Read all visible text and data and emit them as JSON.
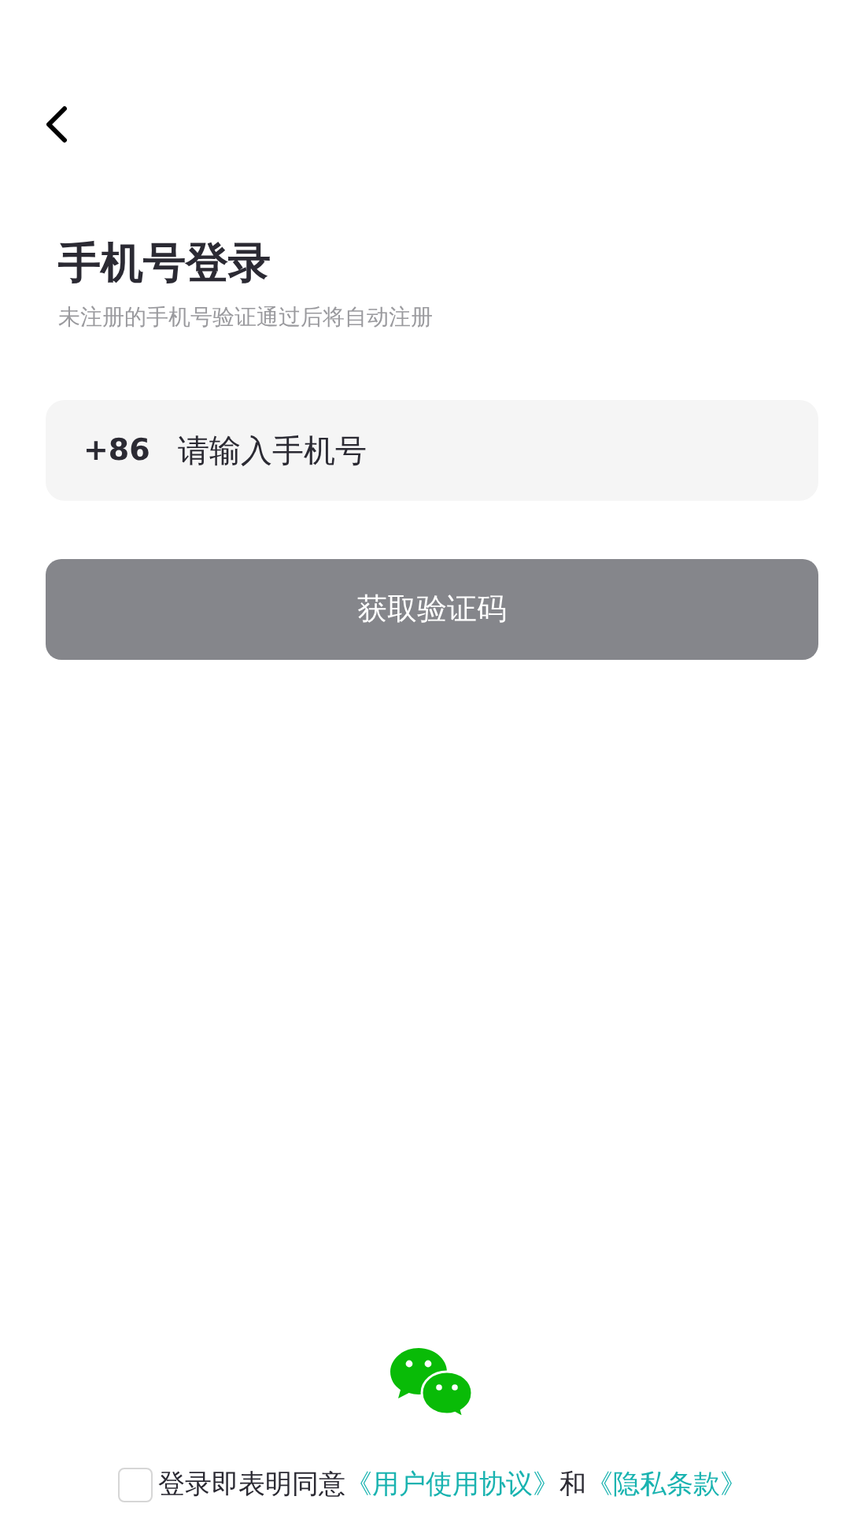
{
  "title": "手机号登录",
  "subtitle": "未注册的手机号验证通过后将自动注册",
  "phone_field": {
    "country_code": "+86",
    "placeholder": "请输入手机号"
  },
  "submit_button": {
    "label": "获取验证码",
    "disabled": true
  },
  "agreement": {
    "checked": false,
    "parts": [
      {
        "kind": "text",
        "text": "登录即表明同意"
      },
      {
        "kind": "link",
        "text": "《用户使用协议》"
      },
      {
        "kind": "text",
        "text": "和"
      },
      {
        "kind": "link",
        "text": "《隐私条款》"
      }
    ]
  }
}
